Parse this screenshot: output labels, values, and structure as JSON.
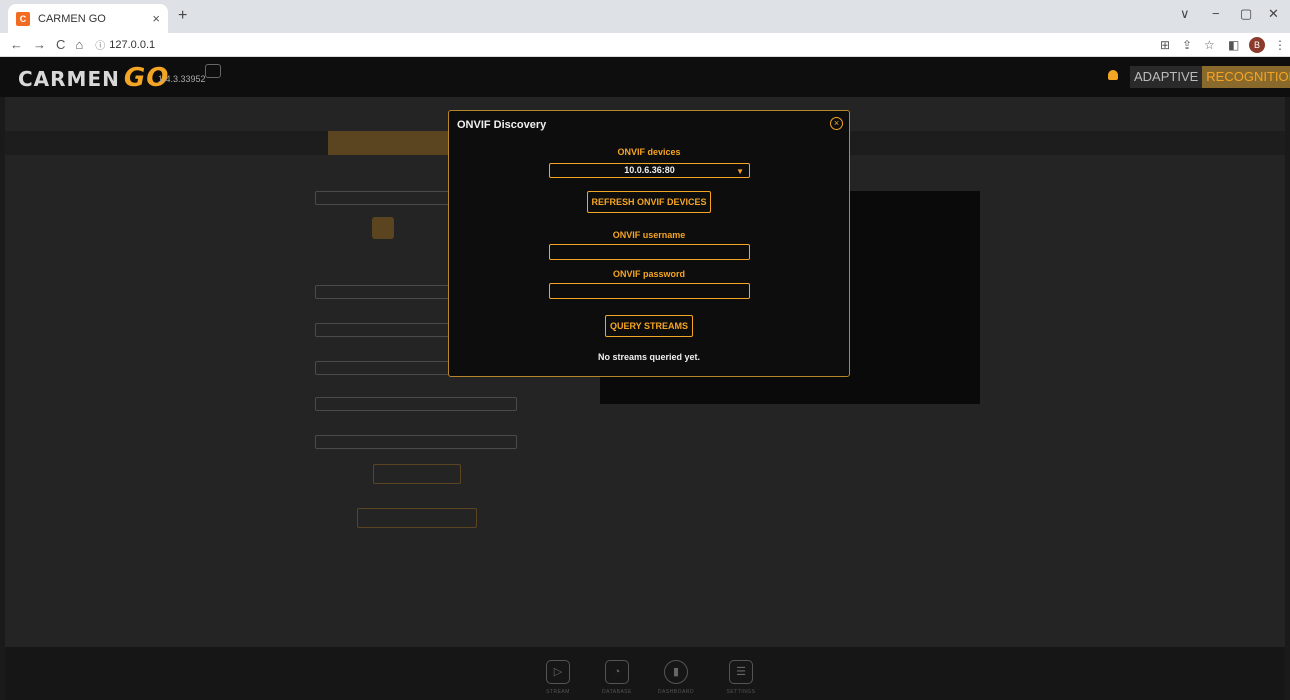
{
  "browser": {
    "tab_title": "CARMEN GO",
    "tab_favicon": "C",
    "tab_close": "×",
    "new_tab": "+",
    "url": "127.0.0.1",
    "nav_back": "←",
    "nav_forward": "→",
    "nav_reload": "C",
    "nav_home": "⌂",
    "info_icon": "ⓘ",
    "profile_initial": "B",
    "win_chevron": "∨",
    "win_min": "−",
    "win_max": "▢",
    "win_close": "✕"
  },
  "app": {
    "logo_text": "CARMEN",
    "logo_go": "GO",
    "version": "1.4.3.33952",
    "brand_adaptive": "ADAPTIVE",
    "brand_recognition": "RECOGNITION",
    "accent_color": "#f5a524"
  },
  "modal": {
    "title": "ONVIF Discovery",
    "close_icon": "×",
    "devices_label": "ONVIF devices",
    "selected_device": "10.0.6.36:80",
    "refresh_button": "REFRESH ONVIF DEVICES",
    "username_label": "ONVIF username",
    "username_value": "",
    "password_label": "ONVIF password",
    "password_value": "",
    "query_button": "QUERY STREAMS",
    "status": "No streams queried yet."
  },
  "bottom_nav": {
    "items": [
      {
        "label": "STREAM",
        "icon": "stream-icon"
      },
      {
        "label": "DATABASE",
        "icon": "database-icon"
      },
      {
        "label": "DASHBOARD",
        "icon": "dashboard-icon"
      },
      {
        "label": "SETTINGS",
        "icon": "settings-icon"
      }
    ]
  }
}
